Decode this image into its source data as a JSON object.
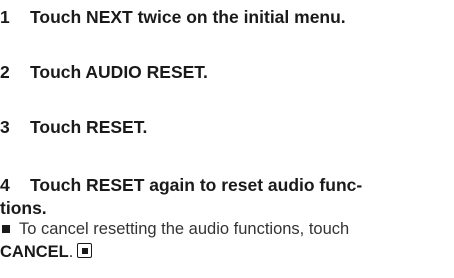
{
  "steps": [
    {
      "number": "1",
      "text": "Touch NEXT twice on the initial menu."
    },
    {
      "number": "2",
      "text": "Touch AUDIO RESET."
    },
    {
      "number": "3",
      "text": "Touch RESET."
    },
    {
      "number": "4",
      "text_line1": "Touch RESET again to reset audio func-",
      "text_line2": "tions."
    }
  ],
  "note": {
    "text": "To cancel resetting the audio functions, touch",
    "bold_word": "CANCEL",
    "trailing": ".",
    "bullet_icon": "square-bullet-icon",
    "end_icon": "end-of-section-icon"
  }
}
